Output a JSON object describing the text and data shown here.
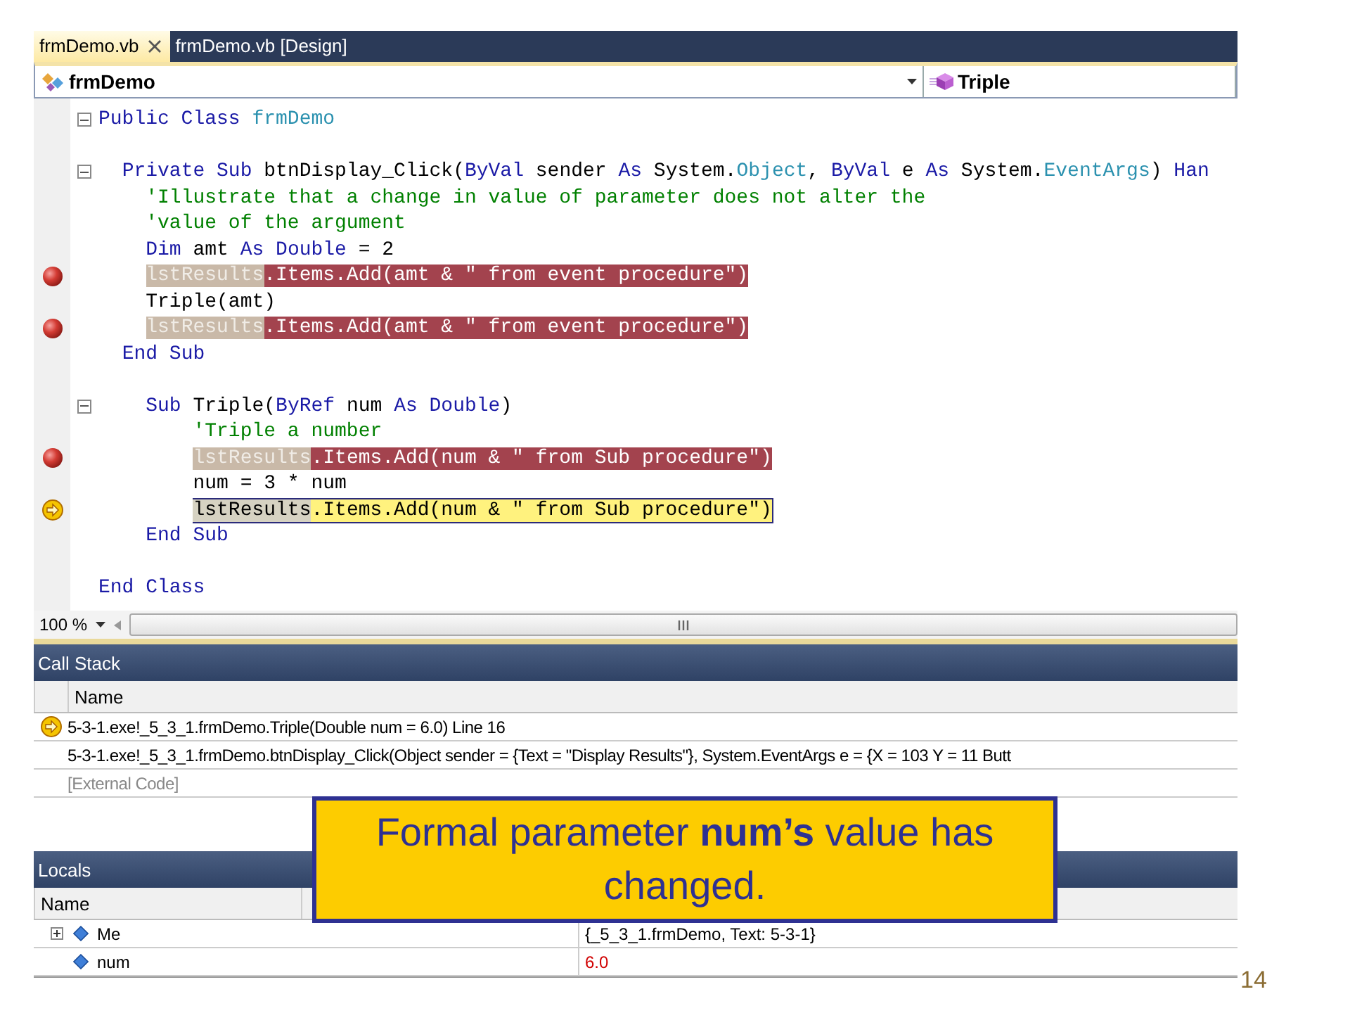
{
  "editor_tabs": [
    {
      "label": "frmDemo.vb",
      "selected": true,
      "closable": true
    },
    {
      "label": "frmDemo.vb [Design]",
      "selected": false,
      "closable": false
    }
  ],
  "navigation_bar": {
    "class_combo": "frmDemo",
    "member_combo": "Triple"
  },
  "code_lines": [
    {
      "kind": "code",
      "breakpoint": false,
      "current": false,
      "fold": true,
      "segments": [
        {
          "text": "Public Class ",
          "kind": "keyword"
        },
        {
          "text": "frmDemo",
          "kind": "type"
        }
      ]
    },
    {
      "kind": "blank"
    },
    {
      "kind": "code",
      "breakpoint": false,
      "current": false,
      "fold": true,
      "segments": [
        {
          "text": "  Private Sub ",
          "kind": "keyword"
        },
        {
          "text": "btnDisplay_Click(",
          "kind": "plain"
        },
        {
          "text": "ByVal",
          "kind": "keyword"
        },
        {
          "text": " sender ",
          "kind": "plain"
        },
        {
          "text": "As",
          "kind": "keyword"
        },
        {
          "text": " System.",
          "kind": "plain"
        },
        {
          "text": "Object",
          "kind": "type"
        },
        {
          "text": ", ",
          "kind": "plain"
        },
        {
          "text": "ByVal",
          "kind": "keyword"
        },
        {
          "text": " e ",
          "kind": "plain"
        },
        {
          "text": "As",
          "kind": "keyword"
        },
        {
          "text": " System.",
          "kind": "plain"
        },
        {
          "text": "EventArgs",
          "kind": "type"
        },
        {
          "text": ") ",
          "kind": "plain"
        },
        {
          "text": "Han",
          "kind": "keyword"
        }
      ]
    },
    {
      "kind": "code",
      "breakpoint": false,
      "current": false,
      "fold": false,
      "segments": [
        {
          "text": "    'Illustrate that a change in value of parameter does not alter the",
          "kind": "comment"
        }
      ]
    },
    {
      "kind": "code",
      "breakpoint": false,
      "current": false,
      "fold": false,
      "segments": [
        {
          "text": "    'value of the argument",
          "kind": "comment"
        }
      ]
    },
    {
      "kind": "code",
      "breakpoint": false,
      "current": false,
      "fold": false,
      "segments": [
        {
          "text": "    Dim",
          "kind": "keyword"
        },
        {
          "text": " amt ",
          "kind": "plain"
        },
        {
          "text": "As Double",
          "kind": "keyword"
        },
        {
          "text": " = 2",
          "kind": "plain"
        }
      ]
    },
    {
      "kind": "code",
      "breakpoint": true,
      "current": false,
      "fold": false,
      "segments": [
        {
          "text": "    lstResults",
          "kind": "bp_name"
        },
        {
          "text": ".Items.Add(amt & \" from event procedure\")",
          "kind": "bp_code"
        }
      ]
    },
    {
      "kind": "code",
      "breakpoint": false,
      "current": false,
      "fold": false,
      "segments": [
        {
          "text": "    Triple(amt)",
          "kind": "plain"
        }
      ]
    },
    {
      "kind": "code",
      "breakpoint": true,
      "current": false,
      "fold": false,
      "segments": [
        {
          "text": "    lstResults",
          "kind": "bp_name"
        },
        {
          "text": ".Items.Add(amt & \" from event procedure\")",
          "kind": "bp_code"
        }
      ]
    },
    {
      "kind": "code",
      "breakpoint": false,
      "current": false,
      "fold": false,
      "segments": [
        {
          "text": "  End Sub",
          "kind": "keyword"
        }
      ]
    },
    {
      "kind": "blank"
    },
    {
      "kind": "code",
      "breakpoint": false,
      "current": false,
      "fold": true,
      "segments": [
        {
          "text": "    Sub",
          "kind": "keyword"
        },
        {
          "text": " Triple(",
          "kind": "plain"
        },
        {
          "text": "ByRef",
          "kind": "keyword"
        },
        {
          "text": " num ",
          "kind": "plain"
        },
        {
          "text": "As Double",
          "kind": "keyword"
        },
        {
          "text": ")",
          "kind": "plain"
        }
      ]
    },
    {
      "kind": "code",
      "breakpoint": false,
      "current": false,
      "fold": false,
      "segments": [
        {
          "text": "        'Triple a number",
          "kind": "comment"
        }
      ]
    },
    {
      "kind": "code",
      "breakpoint": true,
      "current": false,
      "fold": false,
      "segments": [
        {
          "text": "        lstResults",
          "kind": "bp_name"
        },
        {
          "text": ".Items.Add(num & \" from Sub procedure\")",
          "kind": "bp_code"
        }
      ]
    },
    {
      "kind": "code",
      "breakpoint": false,
      "current": false,
      "fold": false,
      "segments": [
        {
          "text": "        num = 3 * num",
          "kind": "plain"
        }
      ]
    },
    {
      "kind": "code",
      "breakpoint": false,
      "current": true,
      "fold": false,
      "segments": [
        {
          "text": "        lstResults",
          "kind": "cur_name"
        },
        {
          "text": ".Items.Add(num & \" from Sub procedure\")",
          "kind": "cur_code"
        }
      ]
    },
    {
      "kind": "code",
      "breakpoint": false,
      "current": false,
      "fold": false,
      "segments": [
        {
          "text": "    End Sub",
          "kind": "keyword"
        }
      ]
    },
    {
      "kind": "blank"
    },
    {
      "kind": "code",
      "breakpoint": false,
      "current": false,
      "fold": false,
      "segments": [
        {
          "text": "End Class",
          "kind": "keyword"
        }
      ]
    }
  ],
  "zoom": "100 %",
  "call_stack": {
    "title": "Call Stack",
    "columns": [
      "Name"
    ],
    "rows": [
      {
        "text": "5-3-1.exe!_5_3_1.frmDemo.Triple(Double num = 6.0) Line 16",
        "kind": "frame",
        "current": true
      },
      {
        "text": "5-3-1.exe!_5_3_1.frmDemo.btnDisplay_Click(Object sender = {Text = \"Display Results\"}, System.EventArgs e = {X = 103 Y = 11 Butt",
        "kind": "frame",
        "current": false
      },
      {
        "text": "[External Code]",
        "kind": "external",
        "current": false
      }
    ]
  },
  "locals": {
    "title": "Locals",
    "columns": [
      "Name"
    ],
    "rows": [
      {
        "name": "Me",
        "value": "{_5_3_1.frmDemo, Text: 5-3-1}",
        "expandable": true,
        "changed": false
      },
      {
        "name": "num",
        "value": "6.0",
        "expandable": false,
        "changed": true
      }
    ]
  },
  "callout": {
    "text": "Formal parameter **num’s** value has changed."
  },
  "slide_number": "14"
}
